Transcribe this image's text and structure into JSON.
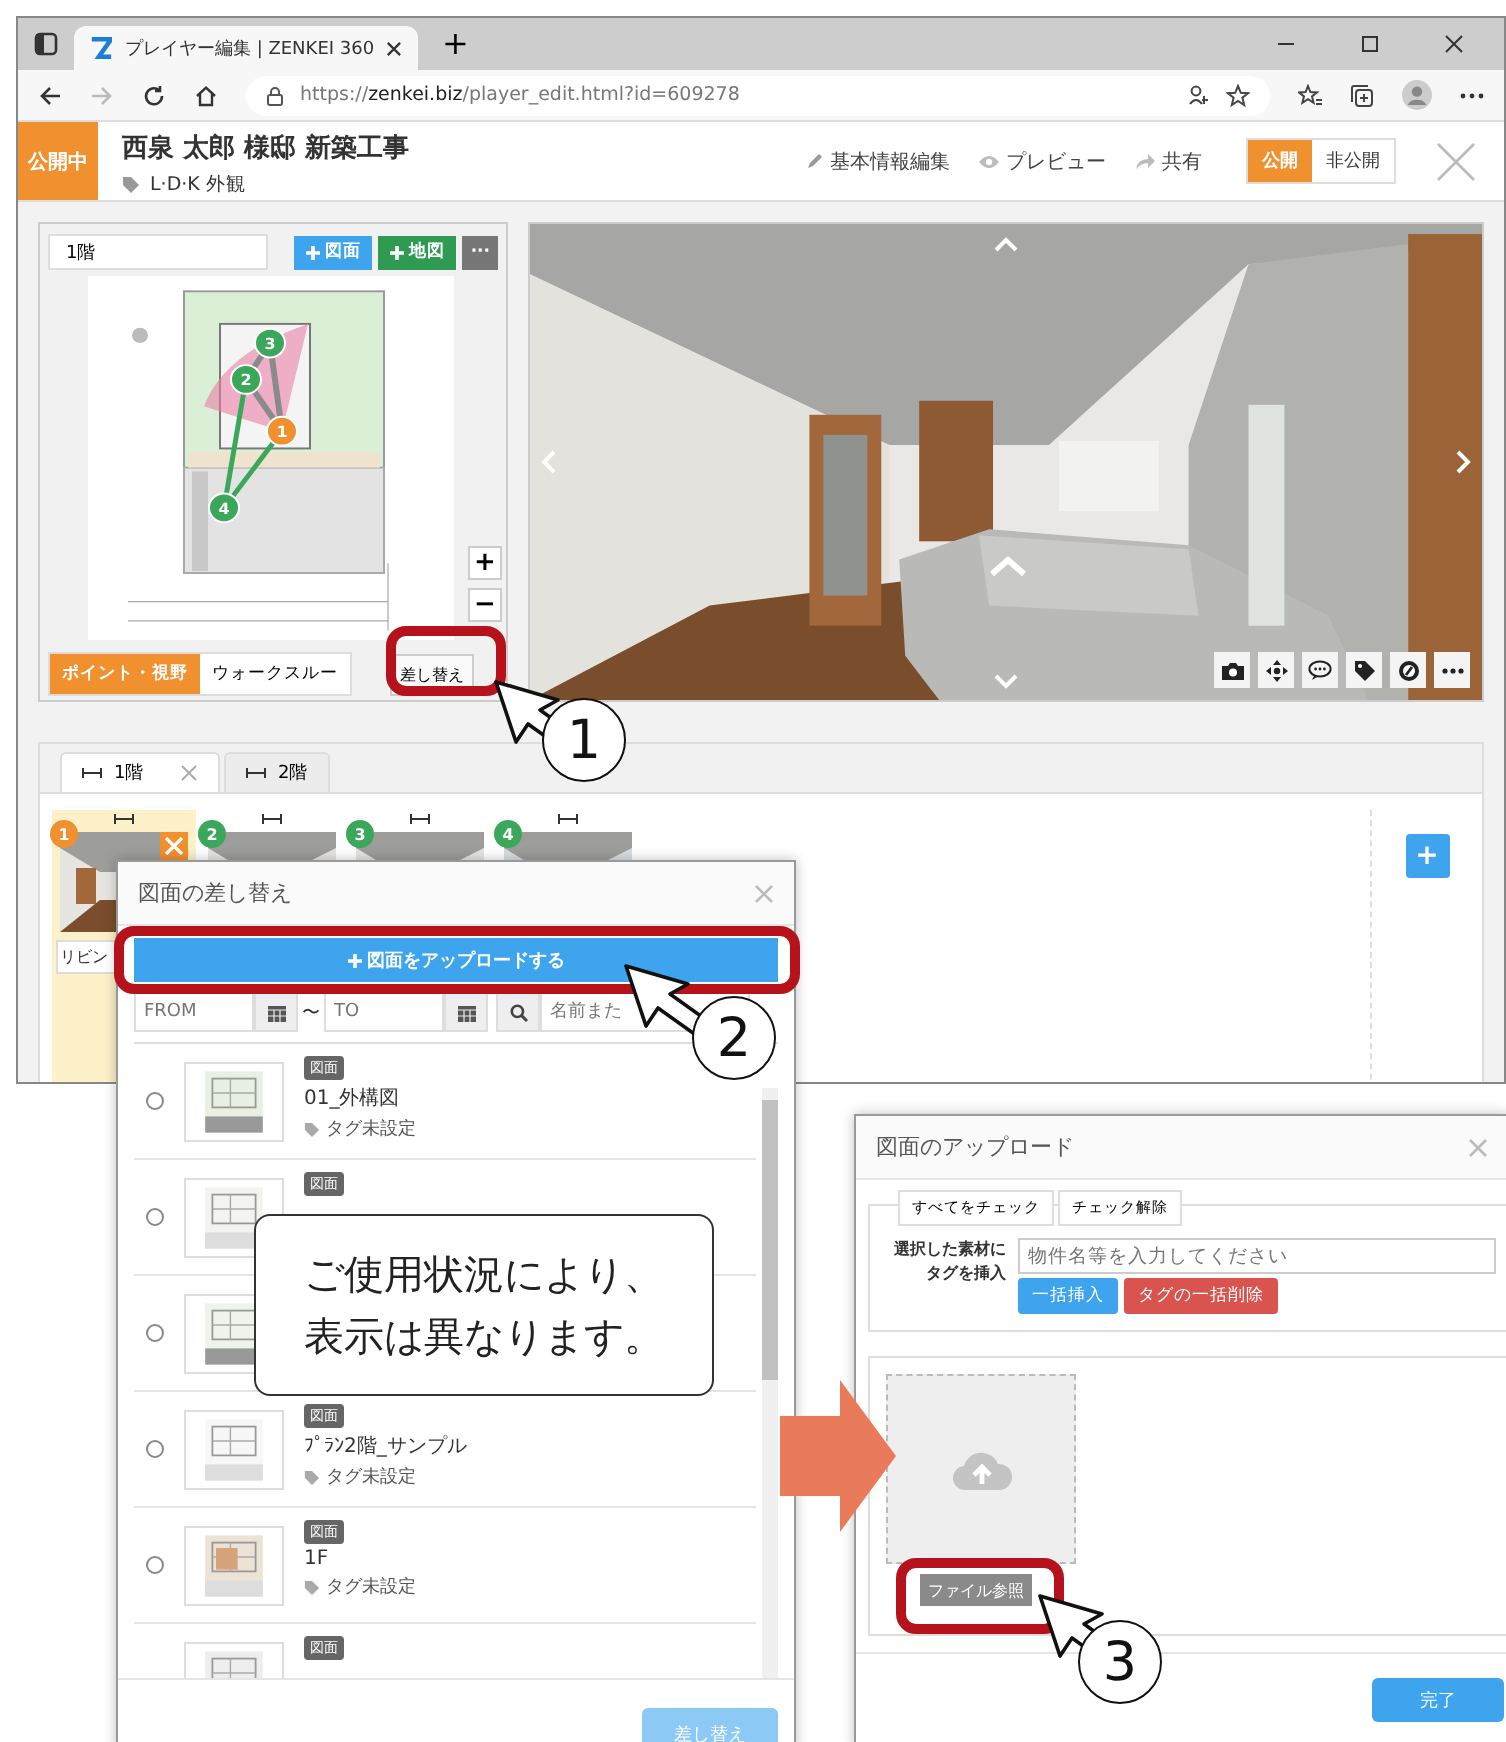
{
  "browser": {
    "tab_title": "プレイヤー編集 | ZENKEI 360",
    "new_tab": "+",
    "url": "https://**zenkei.biz**/player_edit.html?id=609278"
  },
  "header": {
    "status": "公開中",
    "title": "西泉 太郎 様邸 新築工事",
    "tags": "L·D·K 外観",
    "actions": [
      {
        "kind": "edit",
        "label": "基本情報編集"
      },
      {
        "kind": "preview",
        "label": "プレビュー"
      },
      {
        "kind": "share",
        "label": "共有"
      }
    ],
    "visibility": [
      {
        "label": "公開",
        "selected": true
      },
      {
        "label": "非公開",
        "selected": false
      }
    ]
  },
  "floor_panel": {
    "floor_name": "1階",
    "buttons": [
      {
        "kind": "plan",
        "label": "図面"
      },
      {
        "kind": "map",
        "label": "地図"
      },
      {
        "kind": "more",
        "label": "···"
      }
    ],
    "plan_points": [
      {
        "number": "1",
        "selected": true
      },
      {
        "number": "2",
        "selected": false
      },
      {
        "number": "3",
        "selected": false
      },
      {
        "number": "4",
        "selected": false
      }
    ],
    "zoom_buttons": [
      "+",
      "−"
    ],
    "modes": [
      {
        "label": "ポイント・視野",
        "selected": true
      },
      {
        "label": "ウォークスルー",
        "selected": false
      }
    ],
    "replace_button": "差し替え"
  },
  "floor_tabs": [
    {
      "label": "1階",
      "selected": true
    },
    {
      "label": "2階",
      "selected": false
    }
  ],
  "viewpoints": [
    {
      "number": "1",
      "selected": true,
      "label": "リビン"
    },
    {
      "number": "2",
      "selected": false
    },
    {
      "number": "3",
      "selected": false
    },
    {
      "number": "4",
      "selected": false
    }
  ],
  "add_viewpoint": "+",
  "replace_dialog": {
    "title": "図面の差し替え",
    "upload_button": "図面をアップロードする",
    "from_placeholder": "FROM",
    "range_separator": "〜",
    "to_placeholder": "TO",
    "search_placeholder": "名前また",
    "items": [
      {
        "selected": false,
        "badge": "図面",
        "name": "01_外構図",
        "tag": "タグ未設定"
      },
      {
        "selected": false,
        "badge": "図面"
      },
      {
        "selected": false
      },
      {
        "selected": false,
        "badge": "図面",
        "name": "ﾌﾟﾗﾝ2階_サンプル",
        "tag": "タグ未設定"
      },
      {
        "selected": false,
        "badge": "図面",
        "name": "1F",
        "tag": "タグ未設定"
      },
      {
        "badge": "図面"
      }
    ],
    "submit": {
      "label": "差し替え",
      "disabled": true
    }
  },
  "note": [
    "ご使用状況により、",
    "表示は異なります。"
  ],
  "upload_dialog": {
    "title": "図面のアップロード",
    "check_buttons": [
      "すべてをチェック",
      "チェック解除"
    ],
    "tag_label": [
      "選択した素材に",
      "タグを挿入"
    ],
    "tag_placeholder": "物件名等を入力してください",
    "insert_button": "一括挿入",
    "delete_button": "タグの一括削除",
    "browse_button": "ファイル参照",
    "done_button": "完了"
  },
  "callouts": [
    "1",
    "2",
    "3"
  ]
}
